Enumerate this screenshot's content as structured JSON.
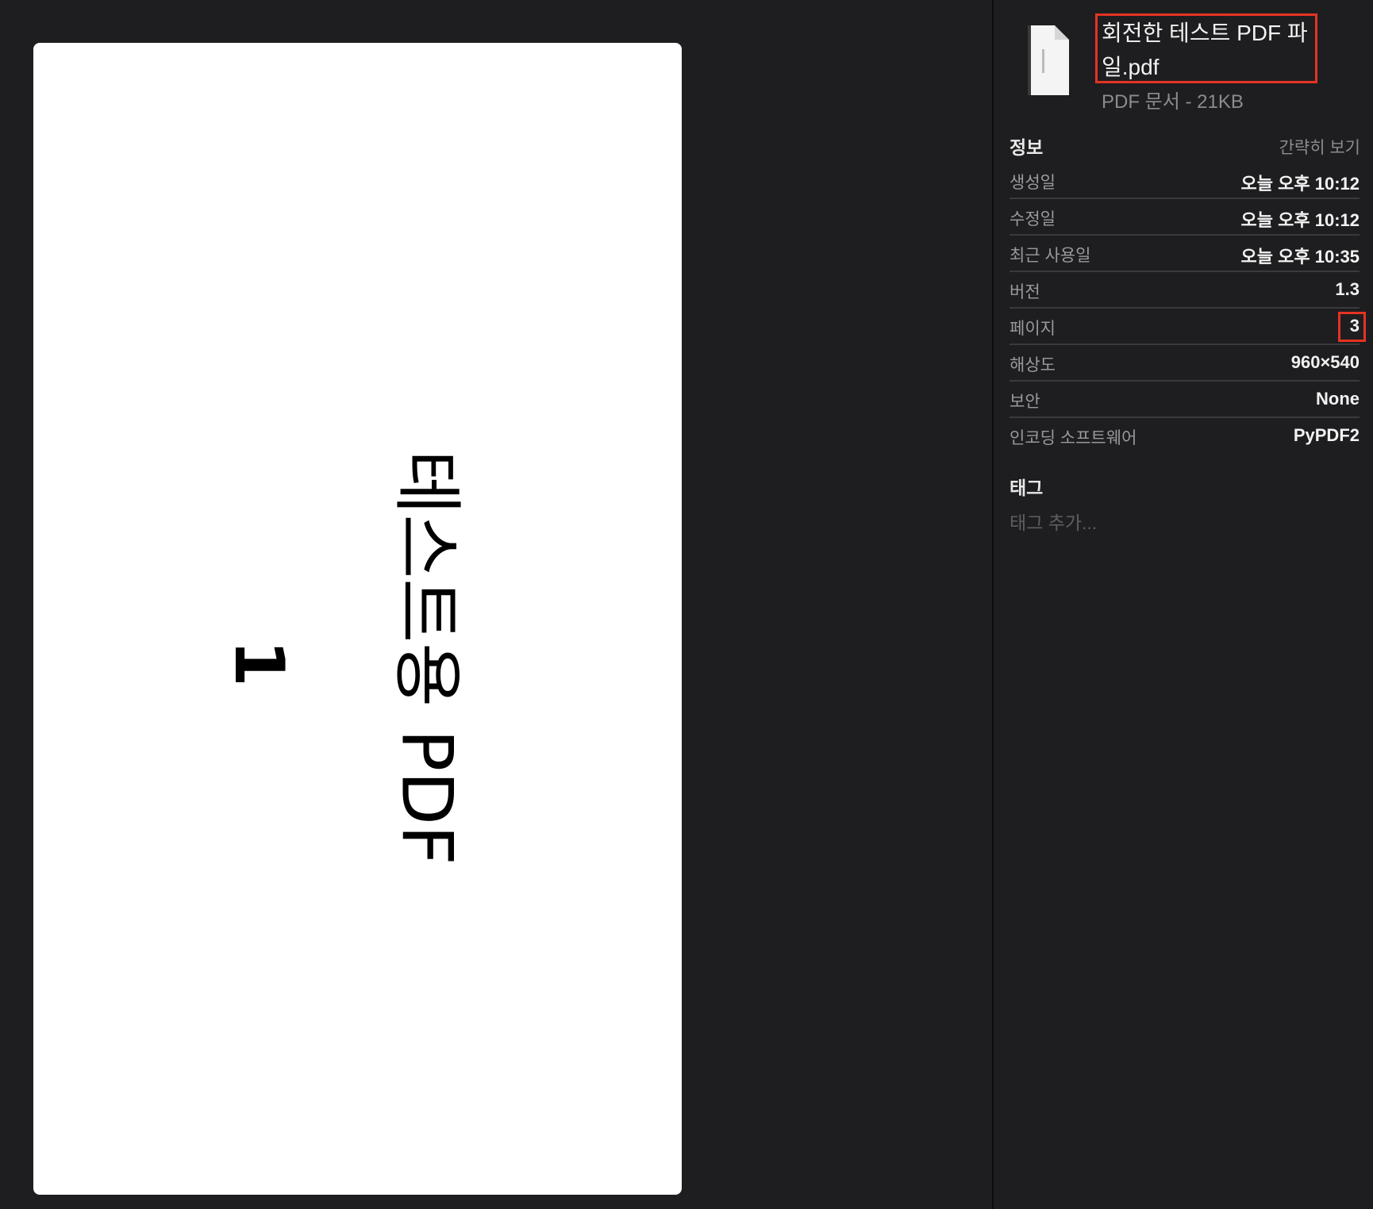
{
  "preview": {
    "page_main_text": "테스트용 PDF",
    "page_number_text": "1"
  },
  "inspector": {
    "file_name": "회전한 테스트 PDF 파일.pdf",
    "file_subtitle": "PDF 문서 - 21KB",
    "info_title": "정보",
    "info_toggle": "간략히 보기",
    "info_rows": [
      {
        "key": "생성일",
        "value": "오늘 오후 10:12"
      },
      {
        "key": "수정일",
        "value": "오늘 오후 10:12"
      },
      {
        "key": "최근 사용일",
        "value": "오늘 오후 10:35"
      },
      {
        "key": "버전",
        "value": "1.3"
      },
      {
        "key": "페이지",
        "value": "3"
      },
      {
        "key": "해상도",
        "value": "960×540"
      },
      {
        "key": "보안",
        "value": "None"
      },
      {
        "key": "인코딩 소프트웨어",
        "value": "PyPDF2"
      }
    ],
    "tags_title": "태그",
    "tags_placeholder": "태그 추가..."
  },
  "colors": {
    "background": "#1e1e20",
    "highlight": "#e53323",
    "page": "#ffffff"
  }
}
